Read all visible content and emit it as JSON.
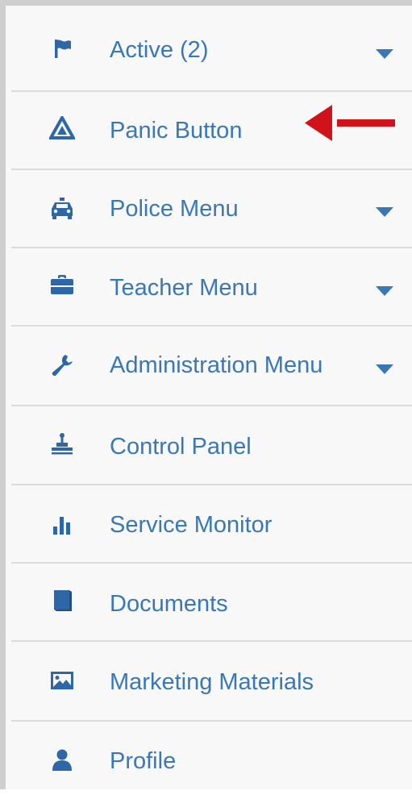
{
  "menu": {
    "items": [
      {
        "label": "Active  (2)",
        "icon": "flag-icon",
        "has_dropdown": true
      },
      {
        "label": "Panic Button",
        "icon": "warning-triangle-icon",
        "has_dropdown": false
      },
      {
        "label": "Police Menu",
        "icon": "police-car-icon",
        "has_dropdown": true
      },
      {
        "label": "Teacher Menu",
        "icon": "briefcase-icon",
        "has_dropdown": true
      },
      {
        "label": "Administration Menu",
        "icon": "wrench-icon",
        "has_dropdown": true
      },
      {
        "label": "Control Panel",
        "icon": "control-panel-icon",
        "has_dropdown": false
      },
      {
        "label": "Service Monitor",
        "icon": "bar-chart-icon",
        "has_dropdown": false
      },
      {
        "label": "Documents",
        "icon": "book-icon",
        "has_dropdown": false
      },
      {
        "label": "Marketing Materials",
        "icon": "image-icon",
        "has_dropdown": false
      },
      {
        "label": "Profile",
        "icon": "user-icon",
        "has_dropdown": false
      }
    ]
  },
  "annotation": {
    "type": "red-arrow",
    "points_to": "Panic Button",
    "color": "#d0121b"
  },
  "colors": {
    "accent": "#3a78b5",
    "icon": "#2f67a6",
    "background": "#f8f8f8",
    "divider": "#dcdcdc",
    "frame": "#cfcfcf"
  }
}
